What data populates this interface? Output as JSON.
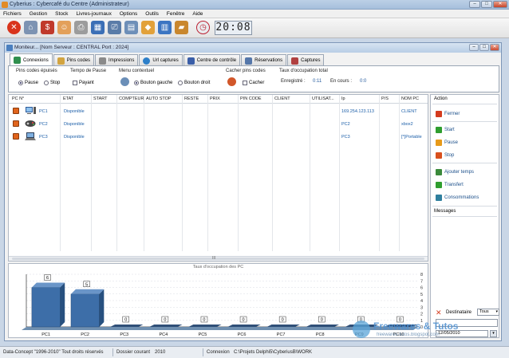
{
  "window": {
    "title": "Cyberius : Cybercafé du Centre (Administrateur)"
  },
  "menu": [
    "Fichiers",
    "Gestion",
    "Stock",
    "Livres-journaux",
    "Options",
    "Outils",
    "Fenêtre",
    "Aide"
  ],
  "toolbar": {
    "icons": [
      "exit-icon",
      "shop-icon",
      "cashbox-icon",
      "user-icon",
      "printer-icon",
      "calendar-icon",
      "network-icon",
      "chart-icon",
      "tag-icon",
      "calculator-icon",
      "folder-icon",
      "alarm-clock-icon"
    ],
    "clock": "20:08"
  },
  "monitor": {
    "title": "Moniteur... [Nom Serveur : CENTRAL   Port : 2024]",
    "tabs": [
      "Connexions",
      "Pins codes",
      "Impressions",
      "Url captures",
      "Centre de contrôle",
      "Réservations",
      "Captures"
    ],
    "active_tab": "Connexions",
    "options": {
      "pins_title": "Pins codes épuisés",
      "pins_pause": "Pause",
      "pins_stop": "Stop",
      "tempo_title": "Tempo de Pause",
      "tempo_payant": "Payant",
      "menu_title": "Menu contextuel",
      "menu_left": "Bouton gauche",
      "menu_right": "Bouton droit",
      "cacher_title": "Cacher pins codes",
      "cacher_label": "Cacher",
      "taux_title": "Taux d'occupation total",
      "enregistre_label": "Enregistré :",
      "enregistre_value": "0:11",
      "encours_label": "En cours :",
      "encours_value": "0:0"
    }
  },
  "table": {
    "columns": [
      "PC N°",
      "ETAT",
      "START",
      "COMPTEUR",
      "AUTO STOP",
      "RESTE",
      "PRIX",
      "PIN CODE",
      "CLIENT",
      "UTILISAT...",
      "Ip",
      "P/S",
      "NOM PC"
    ],
    "rows": [
      {
        "pc": "PC1",
        "etat": "Disponible",
        "ip": "169.254.123.113",
        "ps": "",
        "nom": "CLIENT",
        "device": "desktop"
      },
      {
        "pc": "PC2",
        "etat": "Disponible",
        "ip": "PC2",
        "ps": "",
        "nom": "xbox2",
        "device": "gamepad"
      },
      {
        "pc": "PC3",
        "etat": "Disponible",
        "ip": "PC3",
        "ps": "",
        "nom": "[*]Portable",
        "device": "laptop"
      }
    ],
    "scroll_marker": "III"
  },
  "actions": {
    "title": "Action",
    "items": [
      {
        "label": "Fermer",
        "icon": "close-red-icon",
        "color": "#d43b1e"
      },
      {
        "label": "Start",
        "icon": "play-icon",
        "color": "#2f9e2f"
      },
      {
        "label": "Pause",
        "icon": "pause-icon",
        "color": "#e79a1a"
      },
      {
        "label": "Stop",
        "icon": "stop-icon",
        "color": "#d8501e"
      },
      {
        "label": "Ajouter temps",
        "icon": "add-time-icon",
        "color": "#3b8a3b"
      },
      {
        "label": "Transfert",
        "icon": "transfer-icon",
        "color": "#2f9e2f"
      },
      {
        "label": "Consommations",
        "icon": "consumption-icon",
        "color": "#2f7f9e"
      }
    ],
    "messages_title": "Messages",
    "destinataire_label": "Destinataire",
    "destinataire_value": "Tous",
    "date": "12/05/2010"
  },
  "chart_data": {
    "type": "bar",
    "title": "Taux d'occupation des PC",
    "categories": [
      "PC1",
      "PC2",
      "PC3",
      "PC4",
      "PC5",
      "PC6",
      "PC7",
      "PC8",
      "PC9",
      "PC10"
    ],
    "values": [
      6,
      5,
      0,
      0,
      0,
      0,
      0,
      0,
      0,
      0
    ],
    "ylim": [
      0,
      8
    ],
    "yticks": [
      0,
      1,
      2,
      3,
      4,
      5,
      6,
      7,
      8
    ],
    "grid": true,
    "colors": {
      "bar": "#3d6ea8",
      "bar_side": "#27507f",
      "floor": "#6f8fb0"
    }
  },
  "status": {
    "copyright": "Data-Concept \"1996-2010\"  Tout droits réservés",
    "dossier_label": "Dossier courant",
    "dossier_value": "2010",
    "connexion_label": "Connexion",
    "connexion_value": "C:\\Projets Delphi5\\CyberiusB\\WORK"
  },
  "watermark": {
    "line1": "Freewares & Tutos",
    "line2": "freewares-tutos.blogspot.com"
  }
}
